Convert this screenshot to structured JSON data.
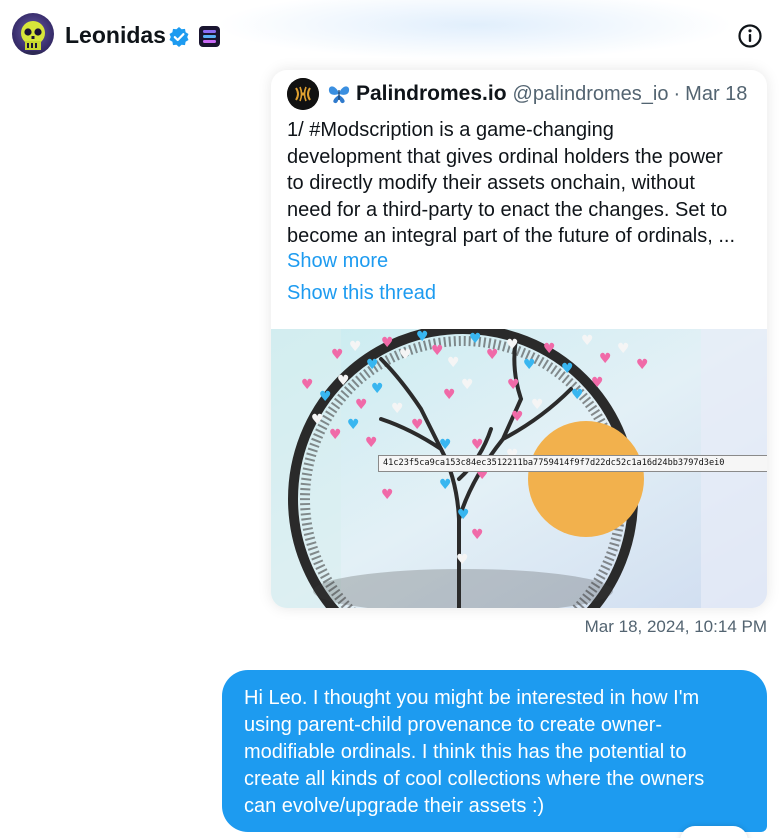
{
  "header": {
    "name": "Leonidas",
    "avatar_icon": "skull-pfp-icon",
    "verified_icon": "verified-badge-icon",
    "badge_icon": "stacks-badge-icon",
    "info_icon": "info-icon"
  },
  "quoted_tweet": {
    "display_name": "Palindromes.io",
    "handle": "@palindromes_io",
    "separator": "·",
    "date": "Mar 18",
    "text_lines": [
      "1/ #Modscription is a game-changing",
      "development that gives ordinal holders the power",
      "to directly modify their assets onchain, without",
      "need for a third-party to enact the changes. Set to",
      "become an integral part of the future of ordinals, ..."
    ],
    "show_more": "Show more",
    "show_thread": "Show this thread",
    "image_tooltip": "41c23f5ca9ca153c84ec3512211ba7759414f9f7d22dc52c1a16d24bb3797d3ei0"
  },
  "message_timestamp": "Mar 18, 2024, 10:14 PM",
  "sent_message": {
    "lines": [
      "Hi Leo. I thought you might be interested in how I'm",
      "using parent-child provenance to create owner-",
      "modifiable ordinals. I think this has the potential to",
      "create all kinds of cool collections where the owners",
      "can evolve/upgrade their assets :)"
    ]
  },
  "colors": {
    "accent": "#1d9bf0",
    "muted": "#536471",
    "text": "#0f1419"
  }
}
